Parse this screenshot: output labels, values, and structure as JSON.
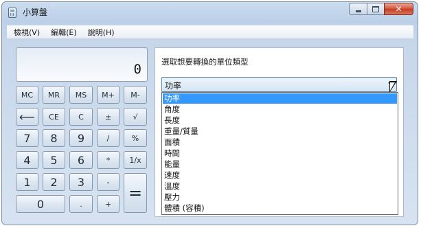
{
  "window": {
    "title": "小算盤"
  },
  "menu": [
    "檢視(V)",
    "編輯(E)",
    "說明(H)"
  ],
  "display": {
    "value": "0"
  },
  "keys": {
    "mc": "MC",
    "mr": "MR",
    "ms": "MS",
    "mplus": "M+",
    "mminus": "M-",
    "backspace": "⟵",
    "ce": "CE",
    "c": "C",
    "plusminus": "±",
    "sqrt": "√",
    "seven": "7",
    "eight": "8",
    "nine": "9",
    "divide": "/",
    "percent": "%",
    "four": "4",
    "five": "5",
    "six": "6",
    "multiply": "*",
    "reciprocal": "1/x",
    "one": "1",
    "two": "2",
    "three": "3",
    "minus": "-",
    "equals": "=",
    "zero": "0",
    "decimal": ".",
    "plus": "+"
  },
  "unit_panel": {
    "label": "選取想要轉換的單位類型",
    "selected": "功率",
    "options": [
      "功率",
      "角度",
      "長度",
      "重量/質量",
      "面積",
      "時間",
      "能量",
      "速度",
      "溫度",
      "壓力",
      "體積 (容積)"
    ]
  },
  "icons": {
    "app": "calculator-icon",
    "minimize": "minimize-icon",
    "maximize": "maximize-icon",
    "close": "close-icon",
    "dropdown": "chevron-down-icon",
    "cursor": "mouse-pointer-icon"
  },
  "colors": {
    "selection": "#3399ff",
    "close_button": "#c43a22",
    "frame": "#bcd0e8"
  }
}
